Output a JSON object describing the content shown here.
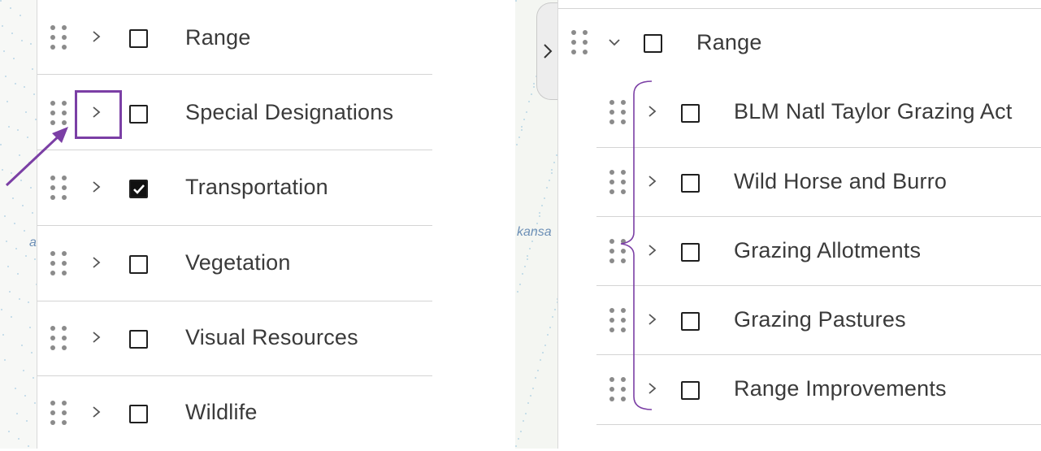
{
  "colors": {
    "accent_annotation": "#7b3fa5",
    "separator": "#d4d4d4",
    "text": "#3a3a3a"
  },
  "left_panel": {
    "items": [
      {
        "label": "Range",
        "checked": false
      },
      {
        "label": "Special Designations",
        "checked": false,
        "highlighted_expand": true
      },
      {
        "label": "Transportation",
        "checked": true
      },
      {
        "label": "Vegetation",
        "checked": false
      },
      {
        "label": "Visual Resources",
        "checked": false
      },
      {
        "label": "Wildlife",
        "checked": false
      }
    ]
  },
  "right_panel": {
    "parent": {
      "label": "Range",
      "checked": false,
      "expanded": true
    },
    "children": [
      {
        "label": "BLM Natl Taylor Grazing Act",
        "checked": false
      },
      {
        "label": "Wild Horse and Burro",
        "checked": false
      },
      {
        "label": "Grazing Allotments",
        "checked": false
      },
      {
        "label": "Grazing Pastures",
        "checked": false
      },
      {
        "label": "Range Improvements",
        "checked": false
      }
    ]
  },
  "map_fragments": {
    "left_text": "a",
    "right_text": "kansa"
  },
  "icons": {
    "drag_handle": "drag-handle-icon",
    "expand": "chevron-right-icon",
    "collapse": "chevron-down-icon",
    "checkbox": "checkbox-icon",
    "panel_toggle": "chevron-right-icon"
  }
}
